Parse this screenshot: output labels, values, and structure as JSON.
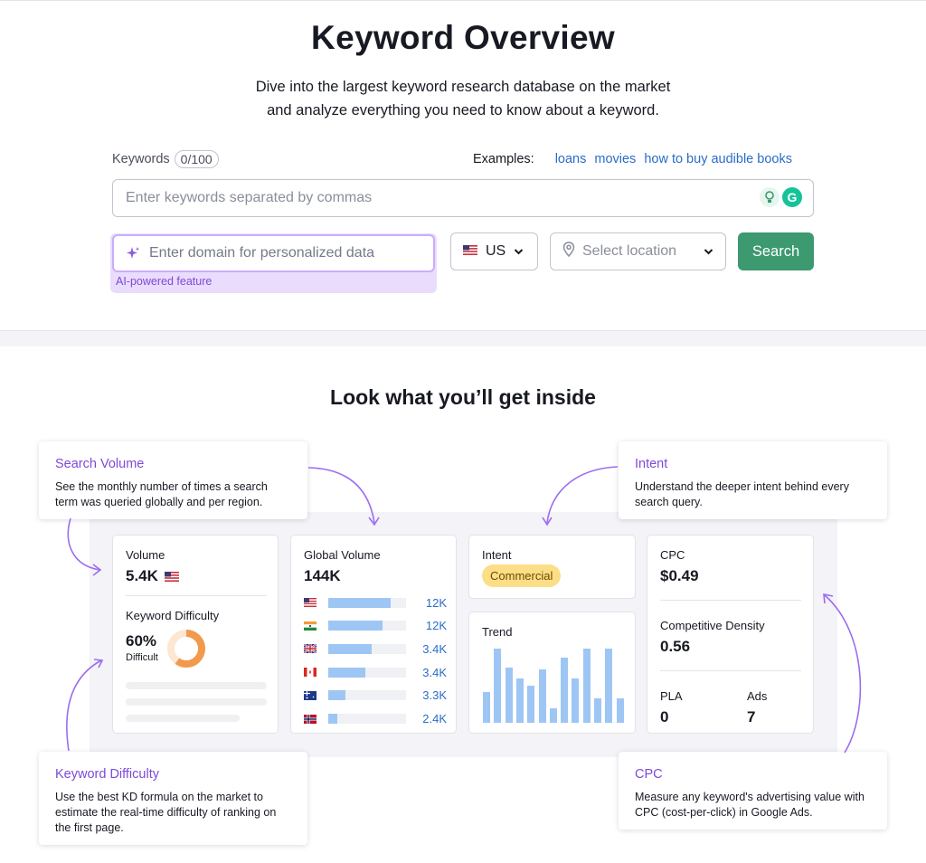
{
  "header": {
    "title": "Keyword Overview",
    "subtitle_line1": "Dive into the largest keyword research database on the market",
    "subtitle_line2": "and analyze everything you need to know about a keyword."
  },
  "form": {
    "keywords_label": "Keywords",
    "keywords_count": "0/100",
    "examples_label": "Examples:",
    "examples": [
      "loans",
      "movies",
      "how to buy audible books"
    ],
    "keywords_placeholder": "Enter keywords separated by commas",
    "domain_placeholder": "Enter domain for personalized data",
    "ai_note": "AI-powered feature",
    "country_value": "US",
    "location_placeholder": "Select location",
    "search_label": "Search"
  },
  "preview": {
    "section_title": "Look what you’ll get inside",
    "volume_label": "Volume",
    "volume_value": "5.4K",
    "kd_label": "Keyword Difficulty",
    "kd_value": "60%",
    "kd_percent": 60,
    "kd_text": "Difficult",
    "global_volume_label": "Global Volume",
    "global_volume_value": "144K",
    "global_rows": [
      {
        "flag": "us-flag-icon",
        "fill": 0.8,
        "value": "12K"
      },
      {
        "flag": "india-flag-icon",
        "fill": 0.7,
        "value": "12K"
      },
      {
        "flag": "uk-flag-icon",
        "fill": 0.56,
        "value": "3.4K"
      },
      {
        "flag": "canada-flag-icon",
        "fill": 0.48,
        "value": "3.4K"
      },
      {
        "flag": "australia-flag-icon",
        "fill": 0.22,
        "value": "3.3K"
      },
      {
        "flag": "norway-flag-icon",
        "fill": 0.12,
        "value": "2.4K"
      }
    ],
    "intent_label": "Intent",
    "intent_value": "Commercial",
    "trend_label": "Trend",
    "trend_values": [
      0.42,
      1.0,
      0.75,
      0.6,
      0.5,
      0.72,
      0.2,
      0.88,
      0.6,
      1.0,
      0.33,
      1.0,
      0.33
    ],
    "cpc_label": "CPC",
    "cpc_value": "$0.49",
    "density_label": "Competitive Density",
    "density_value": "0.56",
    "pla_label": "PLA",
    "pla_value": "0",
    "ads_label": "Ads",
    "ads_value": "7"
  },
  "callouts": {
    "search_volume": {
      "title": "Search Volume",
      "text": "See the monthly number of times a search term was queried globally and per region."
    },
    "intent": {
      "title": "Intent",
      "text": "Understand the deeper intent behind every search query."
    },
    "keyword_difficulty": {
      "title": "Keyword Difficulty",
      "text": "Use the best KD formula on the market to estimate the real-time difficulty of ranking on the first page."
    },
    "cpc": {
      "title": "CPC",
      "text": "Measure any keyword's advertising value with CPC (cost-per-click) in Google Ads."
    }
  },
  "colors": {
    "accent_green": "#3c9970",
    "link_blue": "#2a6dc9",
    "purple": "#7d4ad8",
    "kd_orange": "#f19a4d",
    "bar_blue": "#9ec6f5",
    "intent_yellow": "#fcde87"
  }
}
